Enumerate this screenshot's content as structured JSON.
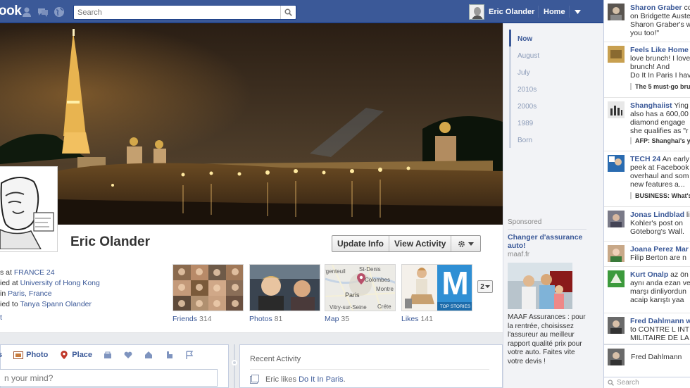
{
  "topbar": {
    "logo": "ook",
    "search_placeholder": "Search",
    "user_name": "Eric Olander",
    "home_label": "Home"
  },
  "profile": {
    "name": "Eric Olander",
    "actions": {
      "update_info": "Update Info",
      "view_activity": "View Activity"
    },
    "about": [
      {
        "prefix": "s at ",
        "link": "FRANCE 24"
      },
      {
        "prefix": "ied at ",
        "link": "University of Hong Kong"
      },
      {
        "prefix": "in ",
        "link": "Paris, France"
      },
      {
        "prefix": "ied to ",
        "link": "Tanya Spann Olander"
      }
    ],
    "about_more": "t"
  },
  "apps": [
    {
      "label": "Friends",
      "count": "314"
    },
    {
      "label": "Photos",
      "count": "81"
    },
    {
      "label": "Map",
      "count": "35"
    },
    {
      "label": "Likes",
      "count": "141"
    }
  ],
  "map_labels": [
    "rgenteuil",
    "St-Denis",
    "Colombes",
    "Paris",
    "Vitry-sur-Seine",
    "Montre",
    "Créte"
  ],
  "likes_tile": {
    "letter": "M",
    "caption": "TOP STORIES"
  },
  "more_apps_label": "2",
  "timeline_nav": [
    "Now",
    "August",
    "July",
    "2010s",
    "2000s",
    "1989",
    "Born"
  ],
  "sponsored": {
    "label": "Sponsored",
    "title": "Changer d'assurance auto!",
    "domain": "maaf.fr",
    "body": "MAAF Assurances : pour la rentrée, choisissez l'assureur au meilleur rapport qualité prix pour votre auto. Faites vite votre devis !"
  },
  "composer": {
    "tab_status": "s",
    "tab_photo": "Photo",
    "tab_place": "Place",
    "placeholder": "n your mind?"
  },
  "activity": {
    "heading": "Recent Activity",
    "item_prefix": "Eric likes ",
    "item_link": "Do It In Paris",
    "item_suffix": "."
  },
  "ticker": [
    {
      "name": "Sharon Graber",
      "lines": [
        "Sharon Graber co",
        "on Bridgette Auste",
        "Sharon Graber's w",
        "you too!\""
      ]
    },
    {
      "name": "Feels Like Home",
      "lines": [
        "Feels Like Home",
        "love brunch! I love",
        "brunch! And",
        "Do It In Paris I hav"
      ],
      "sub": "The 5 must-go bru"
    },
    {
      "name": "Shanghaiist",
      "lines": [
        "Shanghaiist Ying",
        "also has a 600,00",
        "diamond engage",
        "she qualifies as \"r"
      ],
      "sub": "AFP: Shanghai's yo"
    },
    {
      "name": "TECH 24",
      "lines": [
        "TECH 24 An early",
        "peek at Facebook",
        "overhaul and som",
        "new features a..."
      ],
      "sub": "BUSINESS: What's n"
    },
    {
      "name": "Jonas Lindblad",
      "lines": [
        "Jonas Lindblad lik",
        "Kohler's post on",
        "Göteborg's Wall."
      ]
    },
    {
      "name": "Joana Perez Mar",
      "lines": [
        "Joana Perez Mar",
        "Filip Berton are n"
      ]
    },
    {
      "name": "Kurt Onalp",
      "lines": [
        "Kurt Onalp az ön",
        "aynı anda ezan ve",
        "marşı dinliyordun",
        "acaip karıştı yaa"
      ]
    },
    {
      "name": "Fred Dahlmann",
      "lines": [
        "Fred Dahlmann w",
        "to CONTRE L INTE",
        "MILITAIRE DE LA F"
      ]
    }
  ],
  "chat": {
    "name": "Fred Dahlmann",
    "search_placeholder": "Search"
  }
}
